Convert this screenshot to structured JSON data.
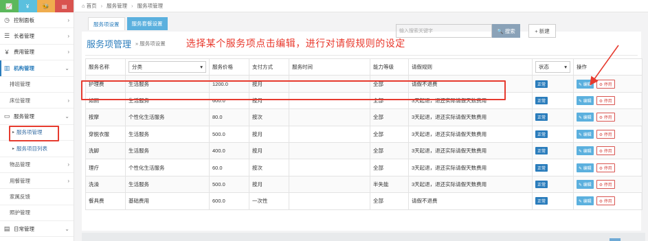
{
  "sidebar": {
    "top_icons": [
      "📈",
      "¥",
      "🐝",
      "▤"
    ],
    "items": [
      {
        "icon": "dashboard-icon",
        "glyph": "◷",
        "label": "控制面板",
        "chevron": "›"
      },
      {
        "icon": "list-icon",
        "glyph": "☰",
        "label": "长者管理",
        "chevron": "›"
      },
      {
        "icon": "yen-icon",
        "glyph": "¥",
        "label": "费用管理",
        "chevron": "›"
      },
      {
        "icon": "building-icon",
        "glyph": "▥",
        "label": "机构管理",
        "chevron": "⌄"
      },
      {
        "label": "排班管理"
      },
      {
        "label": "床位管理",
        "chevron": "›"
      },
      {
        "icon": "service-icon",
        "glyph": "▭",
        "label": "服务管理",
        "chevron": "⌄"
      },
      {
        "label": "服务项管理"
      },
      {
        "label": "服务项目列表"
      },
      {
        "label": "物品管理",
        "chevron": "›"
      },
      {
        "label": "用餐管理",
        "chevron": "›"
      },
      {
        "label": "家属反馈"
      },
      {
        "label": "照护管理"
      },
      {
        "icon": "daily-icon",
        "glyph": "▤",
        "label": "日常管理",
        "chevron": "⌄"
      }
    ]
  },
  "breadcrumb": {
    "home": "首页",
    "level1": "服务管理",
    "level2": "服务项管理"
  },
  "tabs": [
    "服务项设置",
    "服务套餐设置"
  ],
  "page": {
    "title": "服务项管理",
    "subtitle": "» 服务项设置",
    "annotation": "选择某个服务项点击编辑，进行对请假规则的设定",
    "search_placeholder": "输入搜索关键字",
    "search_button": "🔍 搜索",
    "new_button": "+ 新建"
  },
  "table": {
    "headers": [
      "服务名称",
      "分类",
      "服务价格",
      "支付方式",
      "服务时间",
      "能力等级",
      "请假规则",
      "状态",
      "操作"
    ],
    "category_select": "分类",
    "status_select": "状态",
    "edit_label": "✎ 编辑",
    "disable_label": "⚙ 停用",
    "rows": [
      {
        "name": "护理费",
        "category": "生活服务",
        "price": "1200.0",
        "pay": "按月",
        "time": "",
        "level": "全部",
        "rule": "请假不退费",
        "status": "正常"
      },
      {
        "name": "如厕",
        "category": "生活服务",
        "price": "600.0",
        "pay": "按月",
        "time": "",
        "level": "全部",
        "rule": "3天起退，退还实际请假天数费用",
        "status": "正常"
      },
      {
        "name": "按摩",
        "category": "个性化生活服务",
        "price": "80.0",
        "pay": "按次",
        "time": "",
        "level": "全部",
        "rule": "3天起退，退还实际请假天数费用",
        "status": "正常"
      },
      {
        "name": "穿脱衣服",
        "category": "生活服务",
        "price": "500.0",
        "pay": "按月",
        "time": "",
        "level": "全部",
        "rule": "3天起退，退还实际请假天数费用",
        "status": "正常"
      },
      {
        "name": "洗脚",
        "category": "生活服务",
        "price": "400.0",
        "pay": "按月",
        "time": "",
        "level": "全部",
        "rule": "3天起退，退还实际请假天数费用",
        "status": "正常"
      },
      {
        "name": "理疗",
        "category": "个性化生活服务",
        "price": "60.0",
        "pay": "按次",
        "time": "",
        "level": "全部",
        "rule": "3天起退，退还实际请假天数费用",
        "status": "正常"
      },
      {
        "name": "洗澡",
        "category": "生活服务",
        "price": "500.0",
        "pay": "按月",
        "time": "",
        "level": "半失能",
        "rule": "3天起退，退还实际请假天数费用",
        "status": "正常"
      },
      {
        "name": "餐具费",
        "category": "基础费用",
        "price": "600.0",
        "pay": "一次性",
        "time": "",
        "level": "全部",
        "rule": "请假不退费",
        "status": "正常"
      }
    ]
  },
  "colors": {
    "accent": "#2b7dbc",
    "highlight": "#e63a2e",
    "annotation": "#e8382c"
  }
}
